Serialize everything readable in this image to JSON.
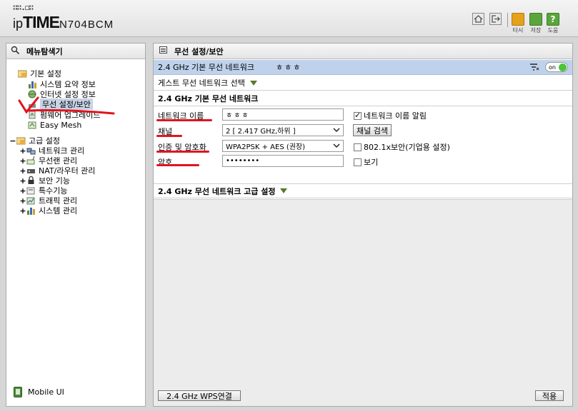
{
  "header": {
    "logo_dots": "∷∷.◻∷",
    "logo_ip": "ip",
    "logo_time": "TIME",
    "logo_model": "N704BCM",
    "buttons": [
      {
        "name": "home-icon"
      },
      {
        "name": "logout-icon"
      }
    ],
    "actions": [
      {
        "label": "타시",
        "color": "#e6a21a"
      },
      {
        "label": "저장",
        "color": "#5aa63c"
      },
      {
        "label": "도움",
        "color": "#5aa63c"
      }
    ]
  },
  "left": {
    "title": "메뉴탐색기",
    "basic": {
      "label": "기본 설정",
      "items": [
        "시스템 요약 정보",
        "인터넷 설정 정보",
        "무선 설정/보안",
        "펌웨어 업그레이드",
        "Easy Mesh"
      ]
    },
    "advanced": {
      "label": "고급 설정",
      "items": [
        "네트워크 관리",
        "무선랜 관리",
        "NAT/라우터 관리",
        "보안 기능",
        "특수기능",
        "트래픽 관리",
        "시스템 관리"
      ]
    },
    "mobile": "Mobile UI"
  },
  "right": {
    "title": "무선 설정/보안",
    "network_bar": {
      "label": "2.4 GHz 기본 무선 네트워크",
      "ssid": "ㅎㅎㅎ",
      "toggle": "on"
    },
    "guest": "게스트 무선 네트워크 선택",
    "section_basic": "2.4 GHz 기본 무선 네트워크",
    "form": {
      "network_name_label": "네트워크 이름",
      "network_name_value": "ㅎㅎㅎ",
      "broadcast_label": "네트워크 이름 알림",
      "channel_label": "채널",
      "channel_value": "2 [ 2.417 GHz,하위 ]",
      "channel_search": "채널 검색",
      "auth_label": "인증 및 암호화",
      "auth_value": "WPA2PSK + AES (권장)",
      "enterprise_label": "802.1x보안(기업용 설정)",
      "password_label": "암호",
      "password_value": "••••••••",
      "show_label": "보기"
    },
    "section_advanced": "2.4 GHz 무선 네트워크 고급 설정",
    "wps_button": "2.4 GHz WPS연결",
    "apply_button": "적용"
  },
  "colors": {
    "highlight": "#bfd2ec",
    "annotation": "#e0141e",
    "toggle_on": "#4cc43a"
  }
}
